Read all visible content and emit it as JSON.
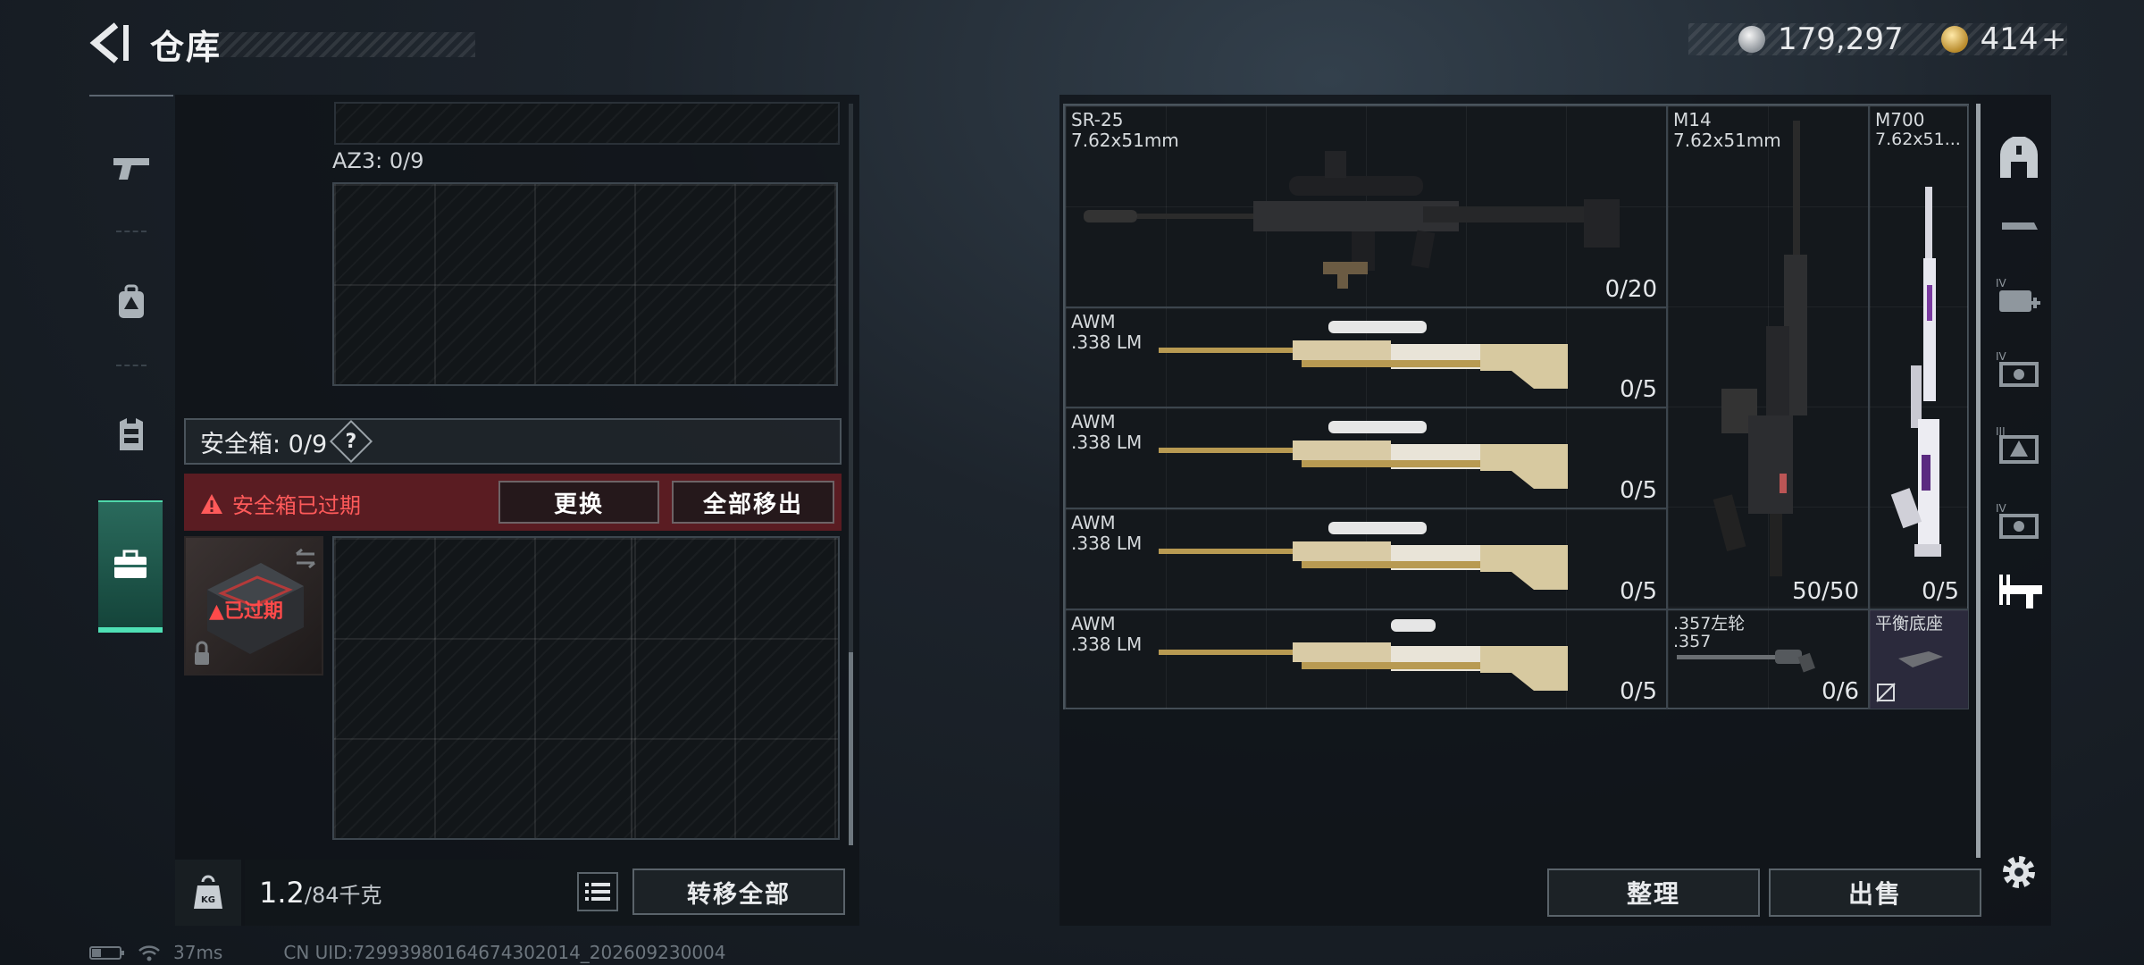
{
  "header": {
    "title": "仓库",
    "silver_amount": "179,297",
    "gold_amount": "414",
    "gold_add": "+"
  },
  "left_rail": {
    "items": [
      "gun-icon",
      "backpack-icon",
      "vest-icon",
      "toolbox-icon"
    ],
    "active": "toolbox-icon"
  },
  "storage": {
    "az3_label": "AZ3: 0/9",
    "safe_label": "安全箱: 0/9",
    "help": "?",
    "expired_warning": "安全箱已过期",
    "replace_button": "更换",
    "remove_all_button": "全部移出",
    "case_status": "已过期"
  },
  "footer": {
    "kg_badge": "KG",
    "weight_value": "1.2",
    "weight_capacity": "/84千克",
    "transfer_all_button": "转移全部",
    "ping": "37ms",
    "uid": "CN UID:7299398016467430201​4_202609230004"
  },
  "weapons": [
    {
      "name": "SR-25",
      "caliber": "7.62x51mm",
      "count": "0/20"
    },
    {
      "name": "M14",
      "caliber": "7.62x51mm",
      "count": "50/50"
    },
    {
      "name": "M700",
      "caliber": "7.62x51...",
      "count": "0/5"
    },
    {
      "name": "AWM",
      "caliber": ".338 LM",
      "count": "0/5"
    },
    {
      "name": "AWM",
      "caliber": ".338 LM",
      "count": "0/5"
    },
    {
      "name": "AWM",
      "caliber": ".338 LM",
      "count": "0/5"
    },
    {
      "name": "AWM",
      "caliber": ".338 LM",
      "count": "0/5"
    },
    {
      "name": ".357左轮",
      "caliber": ".357",
      "count": "0/6"
    },
    {
      "name": "平衡底座",
      "caliber": "",
      "count": ""
    }
  ],
  "right_rail": {
    "items": [
      "all-items-icon",
      "melee-icon",
      "medkit-icon",
      "attachment-icon",
      "supply-icon",
      "key-icon",
      "weapon-icon",
      "settings-icon"
    ],
    "tier_labels": [
      "IV",
      "IV",
      "III",
      "IV"
    ]
  },
  "actions": {
    "tidy_button": "整理",
    "sell_button": "出售"
  },
  "colors": {
    "accent_green": "#4fe0b5",
    "warning_red": "#ff5a5a",
    "expired_bg": "#5a1c22"
  }
}
